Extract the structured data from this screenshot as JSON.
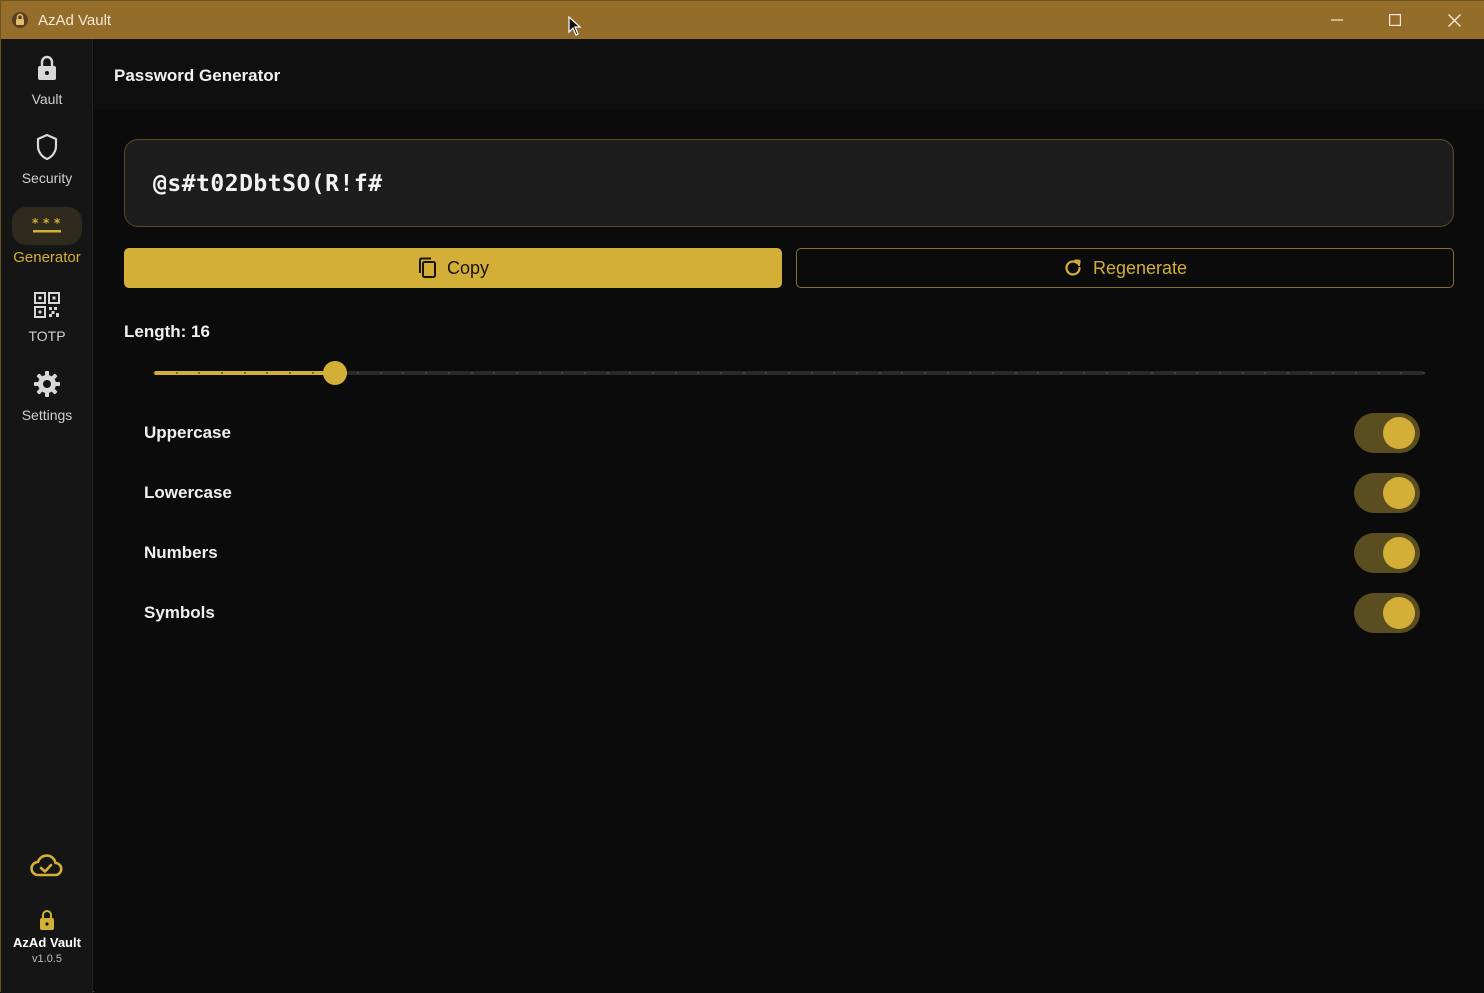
{
  "window": {
    "title": "AzAd Vault"
  },
  "sidebar": {
    "items": [
      {
        "label": "Vault",
        "icon": "lock-icon"
      },
      {
        "label": "Security",
        "icon": "shield-icon"
      },
      {
        "label": "Generator",
        "icon": "password-dots-icon",
        "active": true
      },
      {
        "label": "TOTP",
        "icon": "qr-code-icon"
      },
      {
        "label": "Settings",
        "icon": "gear-icon"
      }
    ],
    "sync_icon": "cloud-check-icon",
    "brand": {
      "name": "AzAd Vault",
      "version": "v1.0.5"
    }
  },
  "header": {
    "title": "Password Generator"
  },
  "generator": {
    "password": "@s#t02DbtSO(R!f#",
    "copy_label": "Copy",
    "regenerate_label": "Regenerate",
    "length_label": "Length: 16",
    "length": {
      "value": 16,
      "min": 8,
      "max": 64
    },
    "options": [
      {
        "label": "Uppercase",
        "enabled": true
      },
      {
        "label": "Lowercase",
        "enabled": true
      },
      {
        "label": "Numbers",
        "enabled": true
      },
      {
        "label": "Symbols",
        "enabled": true
      }
    ]
  },
  "colors": {
    "accent": "#d4af37",
    "titlebar": "#946d2a",
    "background": "#0b0b0b",
    "sidebar": "#151515"
  }
}
